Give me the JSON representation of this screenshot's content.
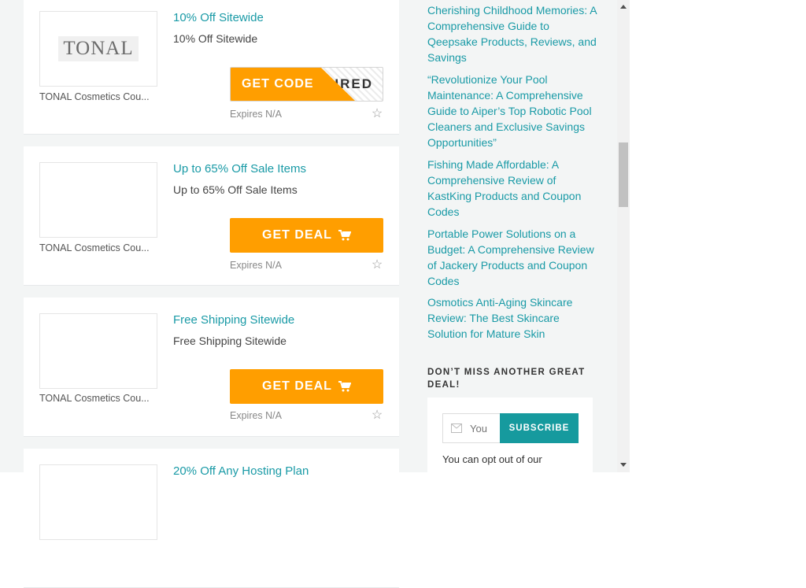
{
  "coupons": [
    {
      "title": "10% Off Sitewide",
      "description": "10% Off Sitewide",
      "store": "TONAL Cosmetics Cou...",
      "logo_text": "TONAL",
      "button_label": "GET CODE",
      "code_reveal": "IRED",
      "expires": "Expires N/A"
    },
    {
      "title": "Up to 65% Off Sale Items",
      "description": "Up to 65% Off Sale Items",
      "store": "TONAL Cosmetics Cou...",
      "button_label": "GET DEAL",
      "expires": "Expires N/A"
    },
    {
      "title": "Free Shipping Sitewide",
      "description": "Free Shipping Sitewide",
      "store": "TONAL Cosmetics Cou...",
      "button_label": "GET DEAL",
      "expires": "Expires N/A"
    },
    {
      "title": "20% Off Any Hosting Plan"
    }
  ],
  "sidebar": {
    "posts": [
      "Cherishing Childhood Memories: A Comprehensive Guide to Qeepsake Products, Reviews, and Savings",
      "“Revolutionize Your Pool Maintenance: A Comprehensive Guide to Aiper’s Top Robotic Pool Cleaners and Exclusive Savings Opportunities”",
      "Fishing Made Affordable: A Comprehensive Review of KastKing Products and Coupon Codes",
      "Portable Power Solutions on a Budget: A Comprehensive Review of Jackery Products and Coupon Codes",
      "Osmotics Anti-Aging Skincare Review: The Best Skincare Solution for Mature Skin"
    ],
    "newsletter_heading": "DON’T MISS ANOTHER GREAT DEAL!",
    "email_placeholder": "You",
    "subscribe_label": "SUBSCRIBE",
    "optout_text": "You can opt out of our"
  },
  "colors": {
    "accent_orange": "#ff9e00",
    "link_teal": "#199aa6",
    "subscribe_teal": "#169a9e"
  },
  "icons": {
    "deal_button": "cart-icon",
    "favorite": "star-icon",
    "email": "mail-icon"
  }
}
